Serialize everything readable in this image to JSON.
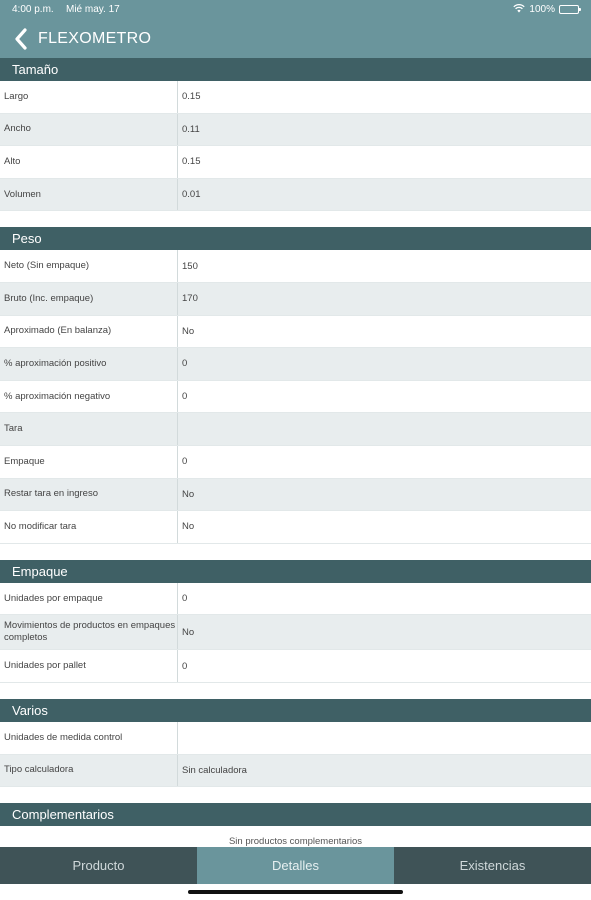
{
  "status": {
    "time": "4:00 p.m.",
    "date": "Mié may. 17",
    "battery": "100%"
  },
  "nav": {
    "title": "FLEXOMETRO"
  },
  "sections": {
    "tamano": {
      "title": "Tamaño",
      "rows": [
        {
          "label": "Largo",
          "value": "0.15"
        },
        {
          "label": "Ancho",
          "value": "0.11"
        },
        {
          "label": "Alto",
          "value": "0.15"
        },
        {
          "label": "Volumen",
          "value": "0.01"
        }
      ]
    },
    "peso": {
      "title": "Peso",
      "rows": [
        {
          "label": "Neto (Sin empaque)",
          "value": "150"
        },
        {
          "label": "Bruto (Inc. empaque)",
          "value": "170"
        },
        {
          "label": "Aproximado (En balanza)",
          "value": "No"
        },
        {
          "label": "% aproximación positivo",
          "value": "0"
        },
        {
          "label": "% aproximación negativo",
          "value": "0"
        },
        {
          "label": "Tara",
          "value": ""
        },
        {
          "label": "Empaque",
          "value": "0"
        },
        {
          "label": "Restar tara en ingreso",
          "value": "No"
        },
        {
          "label": "No modificar tara",
          "value": "No"
        }
      ]
    },
    "empaque": {
      "title": "Empaque",
      "rows": [
        {
          "label": "Unidades por empaque",
          "value": "0"
        },
        {
          "label": "Movimientos de productos en empaques completos",
          "value": "No"
        },
        {
          "label": "Unidades por pallet",
          "value": "0"
        }
      ]
    },
    "varios": {
      "title": "Varios",
      "rows": [
        {
          "label": "Unidades de medida control",
          "value": ""
        },
        {
          "label": "Tipo calculadora",
          "value": "Sin calculadora"
        }
      ]
    },
    "complementarios": {
      "title": "Complementarios",
      "text": "Sin productos complementarios"
    }
  },
  "tabs": [
    {
      "label": "Producto"
    },
    {
      "label": "Detalles"
    },
    {
      "label": "Existencias"
    }
  ],
  "colors": {
    "accent": "#6a959c",
    "header": "#3f6065",
    "tabbar": "#3f5357"
  }
}
